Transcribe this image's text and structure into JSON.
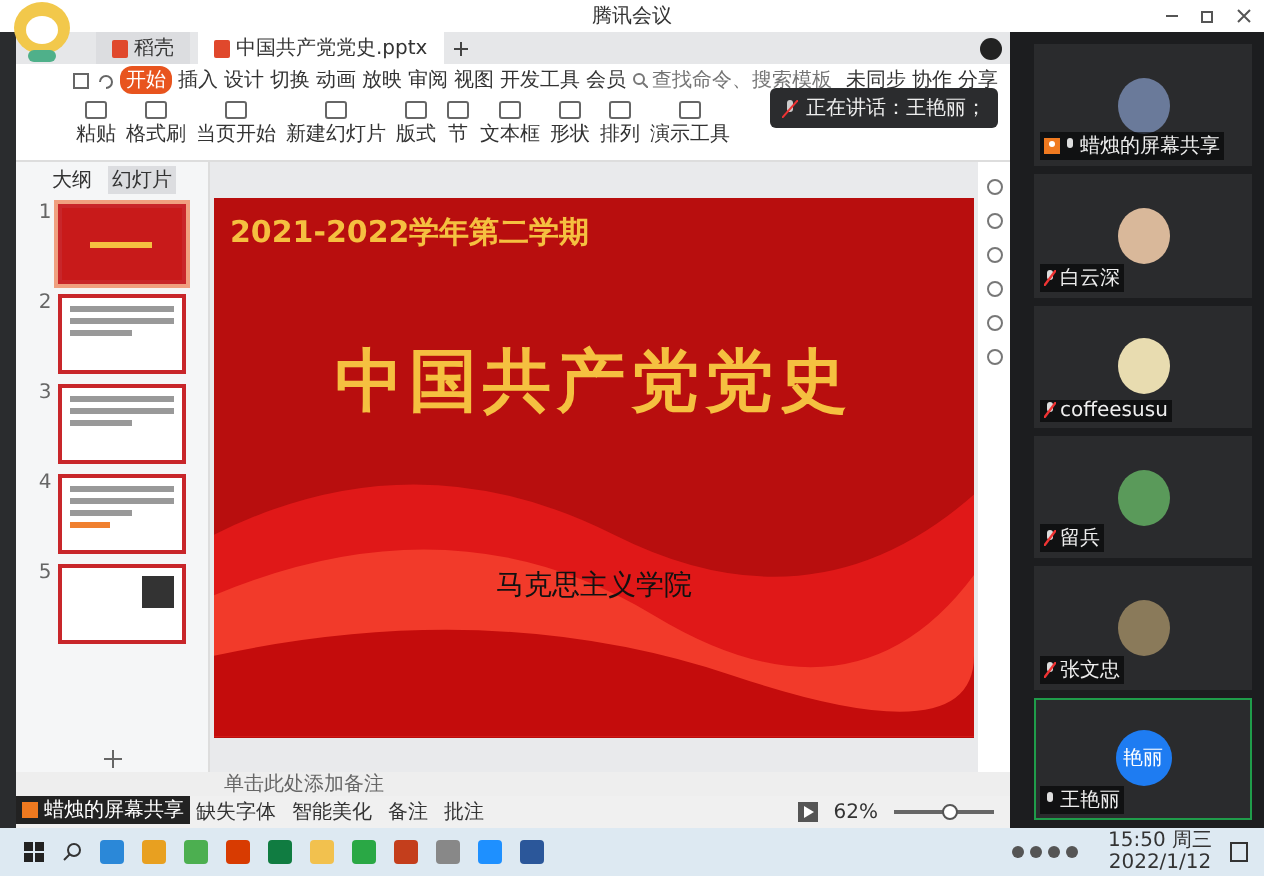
{
  "meeting": {
    "title": "腾讯会议"
  },
  "doc_tabs": [
    {
      "label": "稻壳",
      "selected": false
    },
    {
      "label": "中国共产党党史.pptx",
      "selected": true
    }
  ],
  "ribbon_tabs": [
    {
      "label": "开始",
      "selected": true
    },
    {
      "label": "插入",
      "selected": false
    },
    {
      "label": "设计",
      "selected": false
    },
    {
      "label": "切换",
      "selected": false
    },
    {
      "label": "动画",
      "selected": false
    },
    {
      "label": "放映",
      "selected": false
    },
    {
      "label": "审阅",
      "selected": false
    },
    {
      "label": "视图",
      "selected": false
    },
    {
      "label": "开发工具",
      "selected": false
    },
    {
      "label": "会员",
      "selected": false
    }
  ],
  "search": {
    "placeholder": "查找命令、搜索模板"
  },
  "actions": [
    "未同步",
    "协作",
    "分享"
  ],
  "tools": [
    "粘贴",
    "格式刷",
    "当页开始",
    "新建幻灯片",
    "版式",
    "节",
    "文本框",
    "形状",
    "排列",
    "演示工具"
  ],
  "toast": "正在讲话：王艳丽；",
  "panel_tabs": [
    {
      "label": "大纲",
      "selected": false
    },
    {
      "label": "幻灯片",
      "selected": true
    }
  ],
  "thumbnails": [
    {
      "number": "1",
      "kind": "title",
      "selected": true
    },
    {
      "number": "2",
      "kind": "text",
      "selected": false
    },
    {
      "number": "3",
      "kind": "text",
      "selected": false
    },
    {
      "number": "4",
      "kind": "list",
      "selected": false
    },
    {
      "number": "5",
      "kind": "qr",
      "selected": false
    }
  ],
  "slide": {
    "term": "2021-2022学年第二学期",
    "title": "中国共产党党史",
    "school": "马克思主义学院"
  },
  "notes": {
    "placeholder": "单击此处添加备注"
  },
  "status_bar": {
    "items": [
      "缺失字体",
      "智能美化",
      "备注",
      "批注"
    ],
    "zoom": "62%",
    "level": 0.55
  },
  "share_label": "蜡烛的屏幕共享",
  "participants": [
    {
      "name": "蜡烛的屏幕共享",
      "muted": false,
      "host": true,
      "speaking": false
    },
    {
      "name": "白云深",
      "muted": true,
      "host": false,
      "speaking": false
    },
    {
      "name": "coffeesusu",
      "muted": true,
      "host": false,
      "speaking": false
    },
    {
      "name": "留兵",
      "muted": true,
      "host": false,
      "speaking": false
    },
    {
      "name": "张文忠",
      "muted": true,
      "host": false,
      "speaking": false
    },
    {
      "name": "王艳丽",
      "avatar_text": "艳丽",
      "muted": false,
      "host": false,
      "speaking": true
    }
  ],
  "taskbar": {
    "time": "15:50 周三",
    "date": "2022/1/12"
  }
}
